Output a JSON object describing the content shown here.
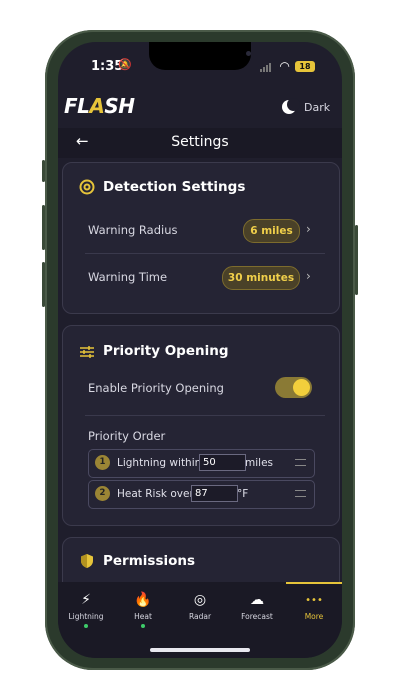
{
  "status": {
    "time": "1:35",
    "battery": "18"
  },
  "header": {
    "logo_left": "FL",
    "logo_mid": "A",
    "logo_right": "SH",
    "theme_label": "Dark"
  },
  "nav": {
    "back": "←",
    "title": "Settings"
  },
  "detection": {
    "title": "Detection Settings",
    "rows": [
      {
        "label": "Warning Radius",
        "value": "6 miles"
      },
      {
        "label": "Warning Time",
        "value": "30 minutes"
      }
    ]
  },
  "priority": {
    "title": "Priority Opening",
    "enable_label": "Enable Priority Opening",
    "enabled": true,
    "order_label": "Priority Order",
    "items": [
      {
        "num": "1",
        "prefix": "Lightning within",
        "value": "50",
        "unit": "miles"
      },
      {
        "num": "2",
        "prefix": "Heat Risk over",
        "value": "87",
        "unit": "°F"
      }
    ]
  },
  "permissions": {
    "title": "Permissions"
  },
  "tabs": [
    {
      "label": "Lightning",
      "icon": "lightning-icon",
      "glyph": "⚡"
    },
    {
      "label": "Heat",
      "icon": "flame-icon",
      "glyph": "🔥"
    },
    {
      "label": "Radar",
      "icon": "radar-icon",
      "glyph": "◎"
    },
    {
      "label": "Forecast",
      "icon": "cloud-icon",
      "glyph": "☁"
    },
    {
      "label": "More",
      "icon": "more-icon",
      "glyph": "•••"
    }
  ],
  "colors": {
    "accent": "#e6c43a",
    "background": "#1f1e2c",
    "card": "#252434",
    "active_dot": "#3ecb6a"
  }
}
